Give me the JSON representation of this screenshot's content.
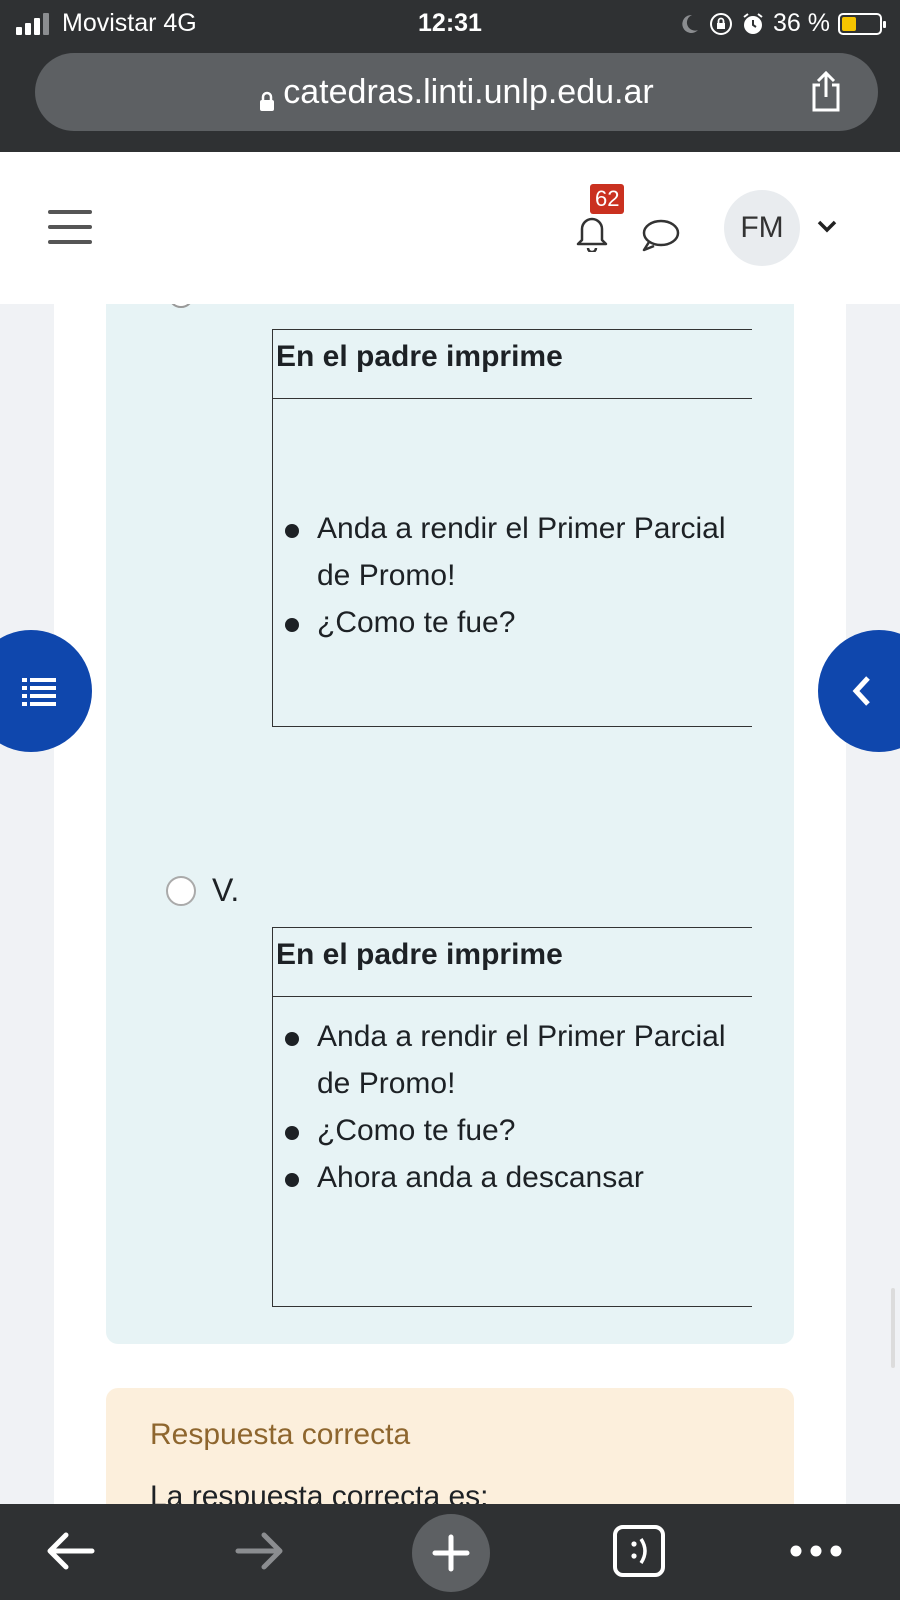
{
  "status_bar": {
    "carrier": "Movistar   4G",
    "time": "12:31",
    "battery": "36 %"
  },
  "browser": {
    "url": "catedras.linti.unlp.edu.ar"
  },
  "header": {
    "notification_count": "62",
    "avatar_initials": "FM"
  },
  "answers": [
    {
      "header": "En el padre imprime",
      "items": [
        "Anda a rendir el Primer Parcial de Promo!",
        "¿Como te fue?"
      ]
    },
    {
      "label": "V.",
      "header": "En el padre imprime",
      "items": [
        "Anda a rendir el Primer Parcial de Promo!",
        "¿Como te fue?",
        "Ahora anda a descansar"
      ]
    }
  ],
  "feedback": {
    "title": "Respuesta correcta",
    "text": "La respuesta correcta es:"
  }
}
